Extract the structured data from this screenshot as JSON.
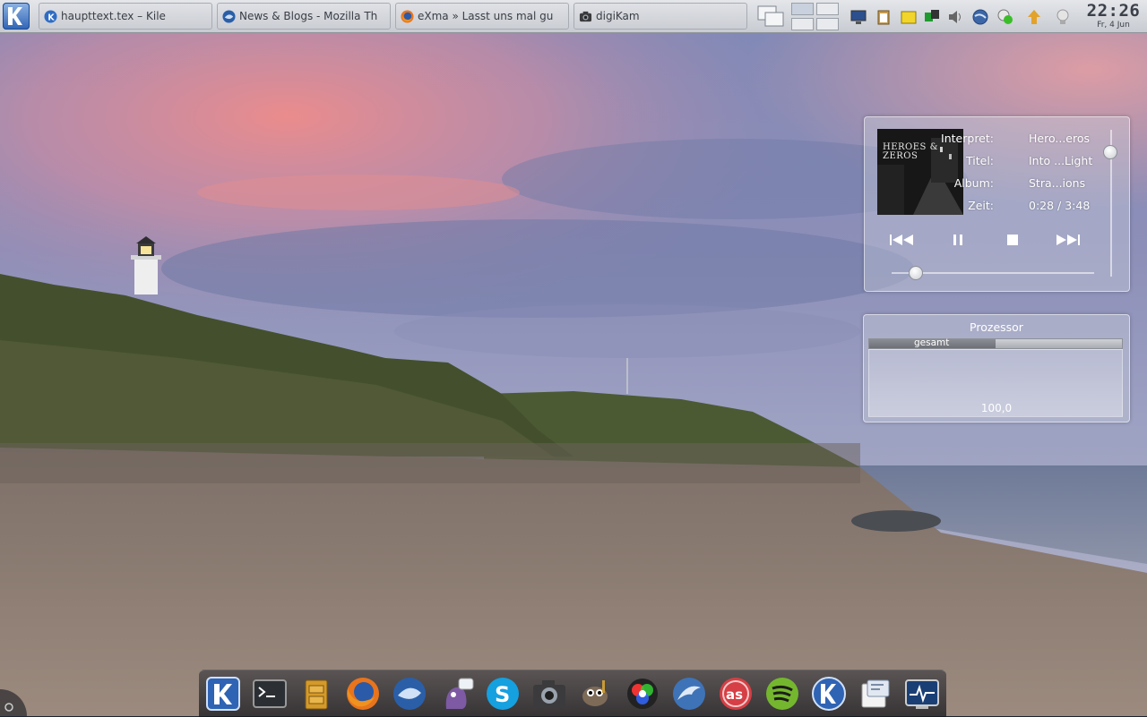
{
  "taskbar": {
    "tasks": [
      {
        "label": "haupttext.tex – Kile",
        "icon": "kile-icon"
      },
      {
        "label": "News & Blogs - Mozilla Th",
        "icon": "thunderbird-icon"
      },
      {
        "label": "eXma » Lasst uns mal gu",
        "icon": "firefox-icon"
      },
      {
        "label": "digiKam",
        "icon": "digikam-icon"
      }
    ]
  },
  "clock": {
    "time": "22:26",
    "date": "Fr, 4 Jun"
  },
  "player": {
    "cover_text": "HEROES & ZEROS",
    "rows": [
      {
        "key": "Interpret:",
        "value": "Hero...eros"
      },
      {
        "key": "Titel:",
        "value": "Into ...Light"
      },
      {
        "key": "Album:",
        "value": "Stra...ions"
      },
      {
        "key": "Zeit:",
        "value": "0:28 / 3:48"
      }
    ],
    "controls": [
      "previous-icon",
      "pause-icon",
      "stop-icon",
      "next-icon"
    ],
    "volume_level": 0.85,
    "seek_position": 0.12
  },
  "cpu": {
    "title": "Prozessor",
    "bar_label": "gesamt",
    "bar_fill": 0.5,
    "value": "100,0"
  },
  "dock": {
    "items": [
      "kde-menu-icon",
      "terminal-icon",
      "file-manager-icon",
      "firefox-icon",
      "thunderbird-icon",
      "pidgin-icon",
      "skype-icon",
      "digikam-icon",
      "gimp-icon",
      "color-picker-icon",
      "dolphin-icon",
      "lastfm-icon",
      "spotify-icon",
      "kde-info-icon",
      "kpresenter-icon",
      "system-monitor-icon"
    ]
  }
}
